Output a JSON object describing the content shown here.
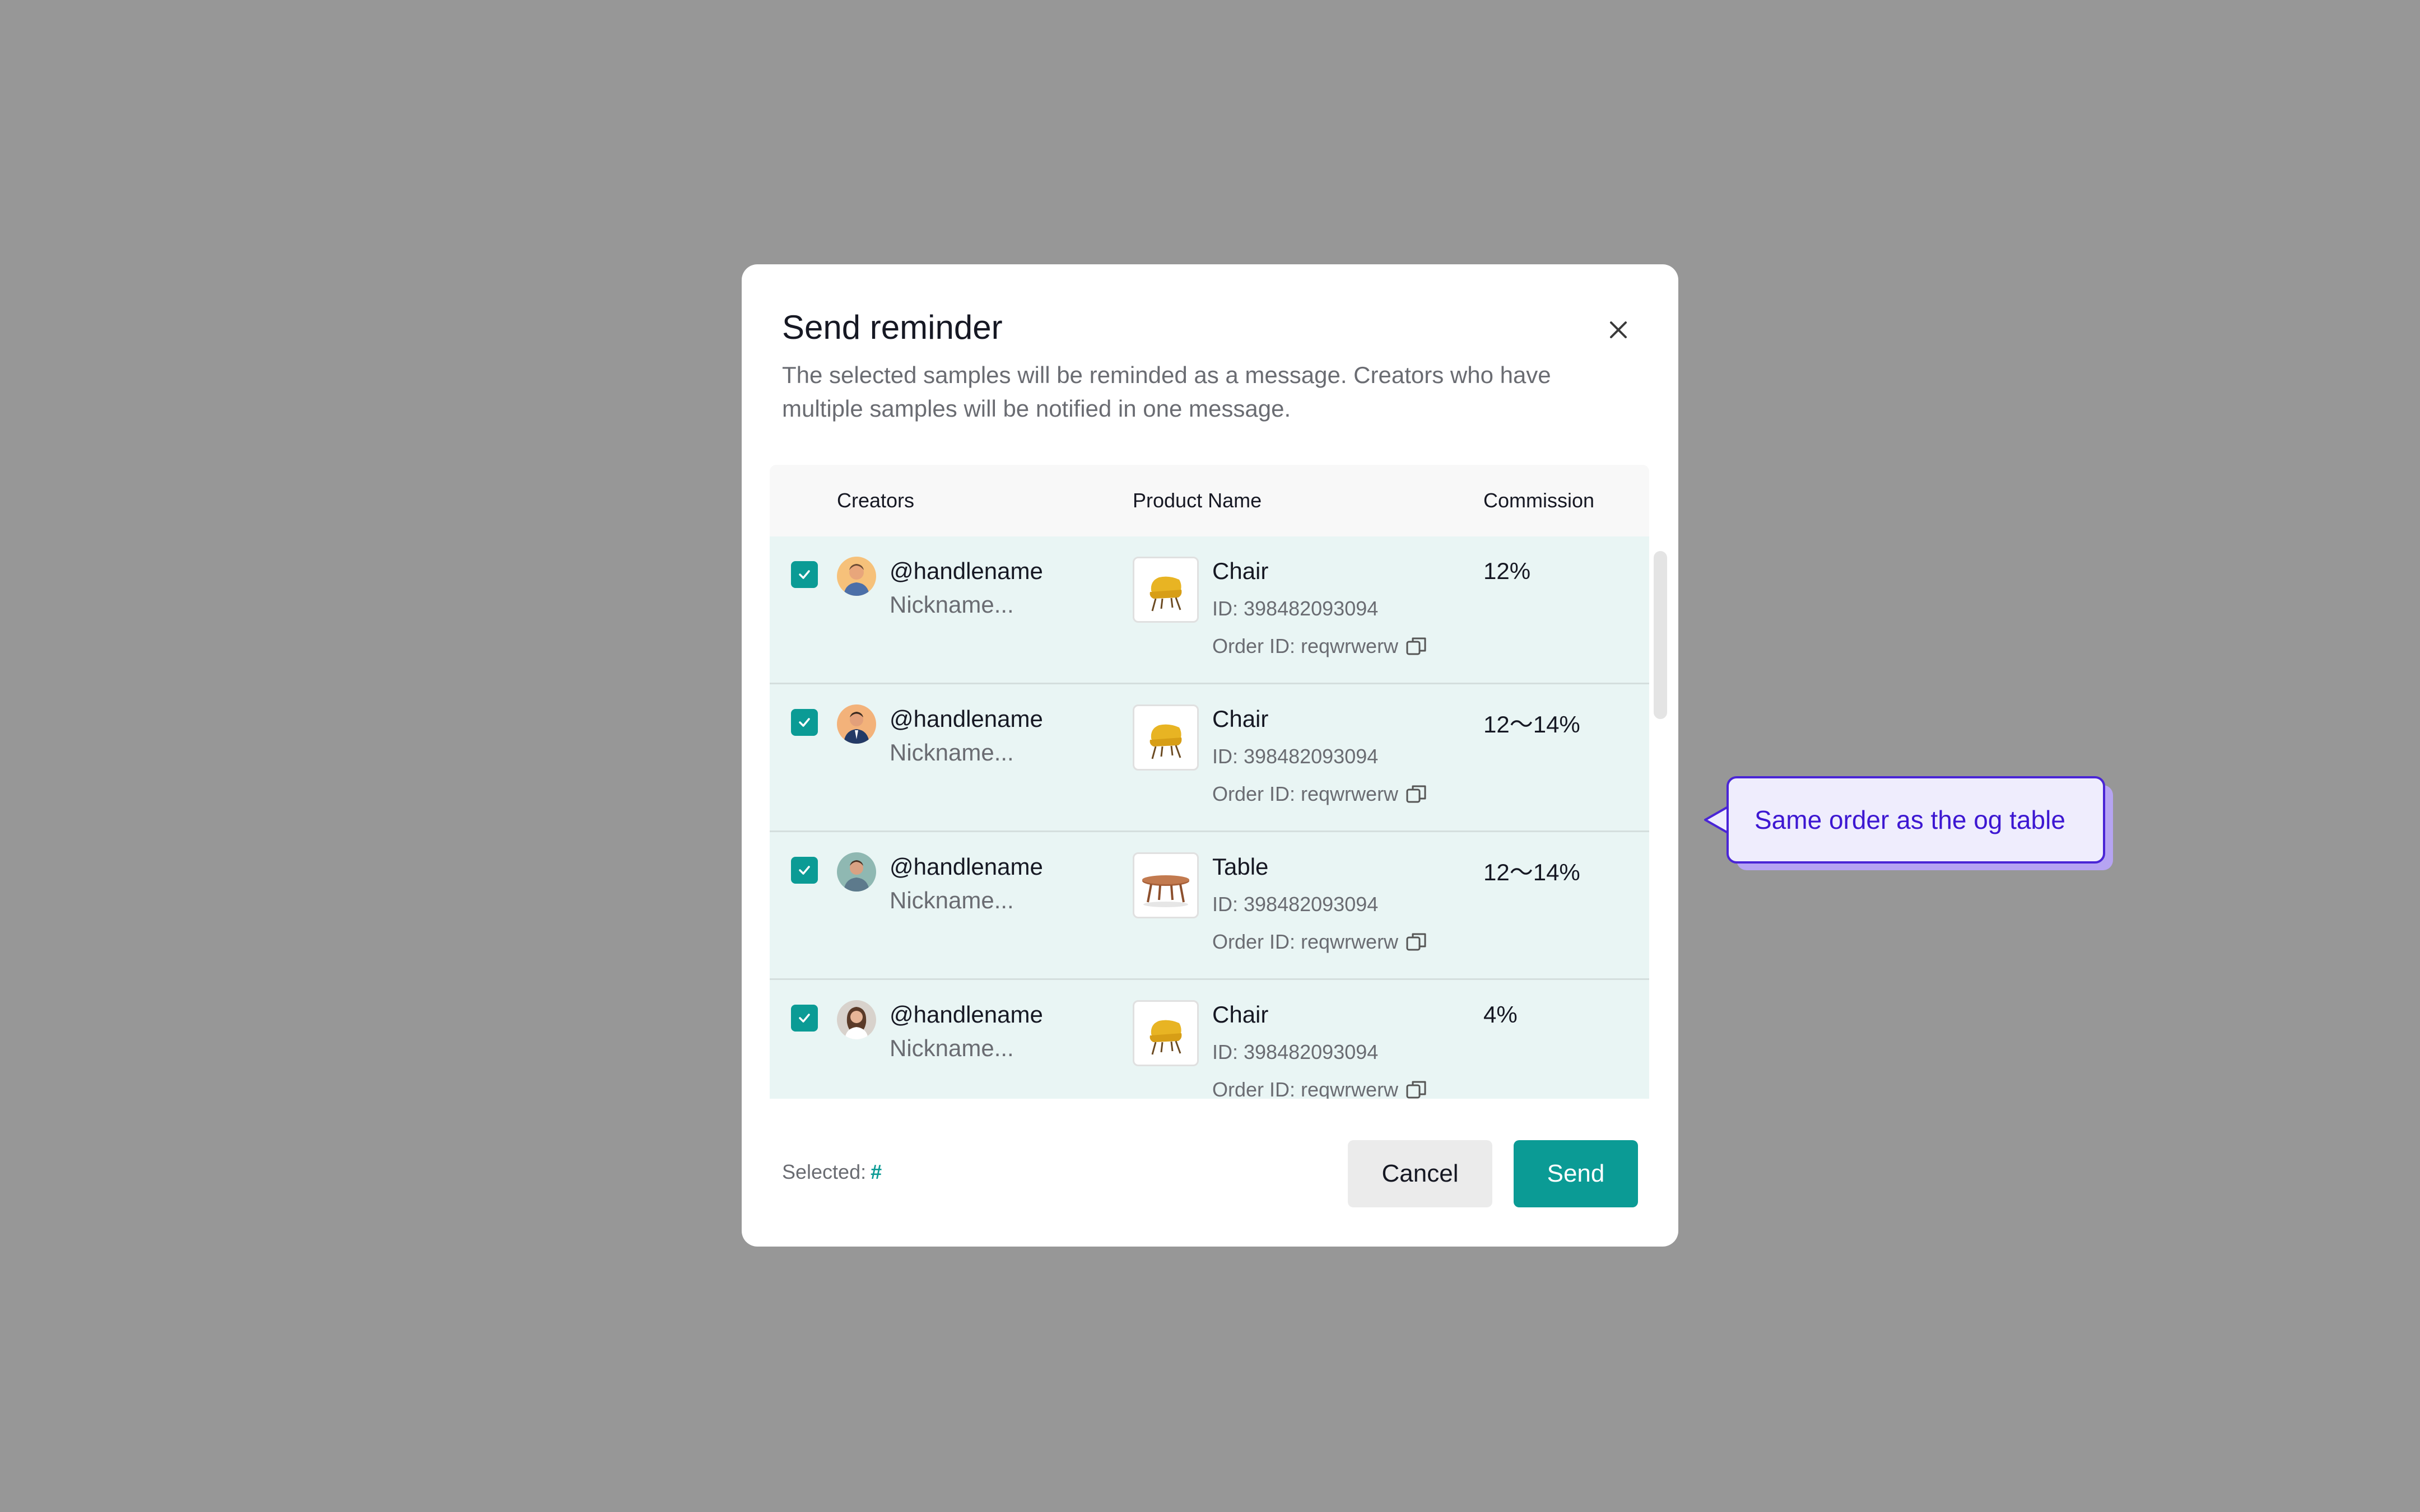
{
  "dialog": {
    "title": "Send reminder",
    "description": "The selected samples will be reminded as a message. Creators who have multiple samples will be notified in one message.",
    "close_icon": "close-icon"
  },
  "table": {
    "headers": {
      "creators": "Creators",
      "product_name": "Product Name",
      "commission": "Commission"
    },
    "rows": [
      {
        "checked": true,
        "handle": "@handlename",
        "nickname": "Nickname...",
        "product": "Chair",
        "product_id": "ID: 398482093094",
        "order_id": "Order ID: reqwrwerw",
        "commission": "12%"
      },
      {
        "checked": true,
        "handle": "@handlename",
        "nickname": "Nickname...",
        "product": "Chair",
        "product_id": "ID: 398482093094",
        "order_id": "Order ID: reqwrwerw",
        "commission": "12～14%"
      },
      {
        "checked": true,
        "handle": "@handlename",
        "nickname": "Nickname...",
        "product": "Table",
        "product_id": "ID: 398482093094",
        "order_id": "Order ID: reqwrwerw",
        "commission": "12～14%"
      },
      {
        "checked": true,
        "handle": "@handlename",
        "nickname": "Nickname...",
        "product": "Chair",
        "product_id": "ID: 398482093094",
        "order_id": "Order ID: reqwrwerw",
        "commission": "4%"
      }
    ]
  },
  "footer": {
    "selected_label": "Selected:",
    "selected_value": "#",
    "cancel_label": "Cancel",
    "send_label": "Send"
  },
  "annotation": {
    "text": "Same order as the og table"
  },
  "colors": {
    "accent": "#0b9b95",
    "row_bg": "#e9f5f4",
    "callout_border": "#4a25d6",
    "callout_text": "#3d17d2",
    "overlay": "#979797"
  }
}
